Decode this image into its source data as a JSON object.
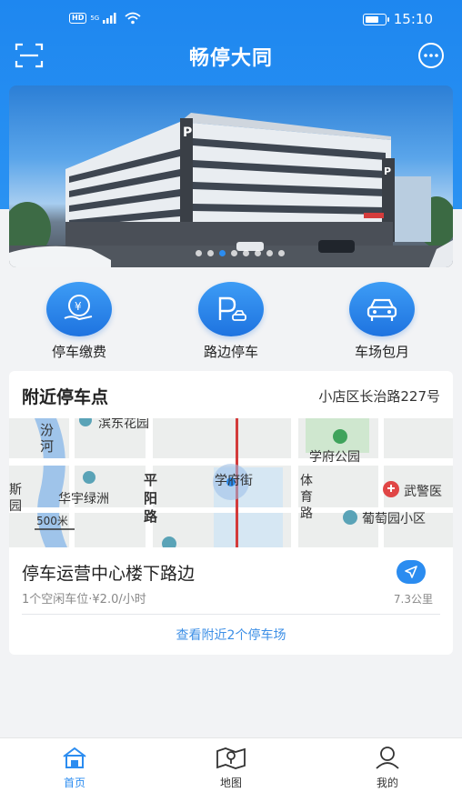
{
  "status_bar": {
    "hd": "HD",
    "network": "5G",
    "time": "15:10"
  },
  "header": {
    "title": "畅停大同",
    "left_icon": "scan-icon",
    "right_icon": "message-icon"
  },
  "banner": {
    "dots": 8,
    "active_dot": 2
  },
  "actions": [
    {
      "label": "停车缴费",
      "icon": "payment-icon"
    },
    {
      "label": "路边停车",
      "icon": "roadside-parking-icon"
    },
    {
      "label": "车场包月",
      "icon": "car-icon"
    }
  ],
  "nearby": {
    "title": "附近停车点",
    "address": "小店区长治路227号",
    "map_labels": {
      "l1": "滨东花园",
      "l2": "汾",
      "l3": "河",
      "l4": "学府公园",
      "l5": "华宇绿洲",
      "l6": "学府街",
      "l7": "武警医",
      "l8": "葡萄园小区",
      "l9": "平",
      "l10": "阳",
      "l11": "路",
      "l12": "体",
      "l13": "育",
      "l14": "路",
      "l15": "斯",
      "l16": "园",
      "scale": "500米"
    },
    "lot": {
      "name": "停车运营中心楼下路边",
      "info": "1个空闲车位·¥2.0/小时",
      "distance": "7.3公里"
    },
    "more_link": "查看附近2个停车场"
  },
  "bottom_nav": [
    {
      "label": "首页",
      "icon": "home-icon",
      "active": true
    },
    {
      "label": "地图",
      "icon": "map-icon",
      "active": false
    },
    {
      "label": "我的",
      "icon": "user-icon",
      "active": false
    }
  ],
  "colors": {
    "primary": "#2b8cf0",
    "header": "#1e87f0"
  }
}
